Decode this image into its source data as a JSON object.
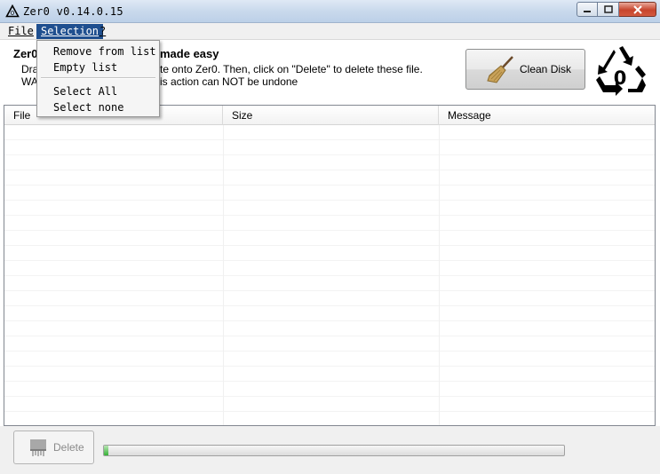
{
  "window": {
    "title": "Zer0 v0.14.0.15"
  },
  "menu": {
    "file": "File",
    "selection": "Selection",
    "help": "?"
  },
  "selection_menu": {
    "items": [
      "Remove from list",
      "Empty list",
      "Select All",
      "Select none"
    ]
  },
  "header": {
    "title_start": "Zer0",
    "title_end": "made easy",
    "line1_start": "Dra",
    "line1_end": "te onto Zer0. Then, click on \"Delete\" to delete these file.",
    "line2_start": "WA",
    "line2_end": "is action can NOT be undone"
  },
  "clean_disk": {
    "label": "Clean Disk",
    "icon": "broom-icon"
  },
  "logo": {
    "text": "0",
    "icon": "recycle-icon"
  },
  "list": {
    "columns": [
      "File",
      "Size",
      "Message"
    ],
    "rows": []
  },
  "delete_button": {
    "label": "Delete",
    "enabled": false
  },
  "progress": {
    "value": 0.01
  },
  "colors": {
    "menu_highlight": "#1f4f8f",
    "progress_green": "#37b237",
    "close_red": "#c7452d"
  }
}
